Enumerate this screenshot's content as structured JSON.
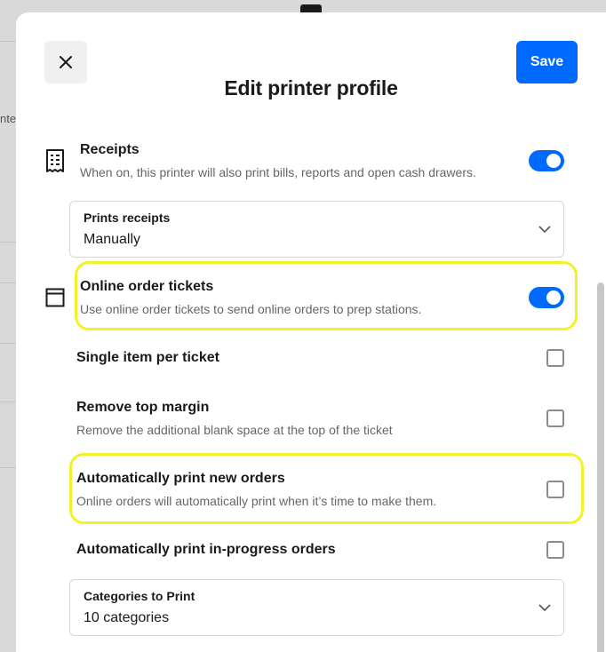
{
  "background": {
    "partial_text": "nte"
  },
  "header": {
    "title": "Edit printer profile",
    "save_label": "Save",
    "close_icon": "close-icon"
  },
  "receipts": {
    "label": "Receipts",
    "description": "When on, this printer will also print bills, reports and open cash drawers.",
    "icon": "receipt-icon",
    "enabled": true
  },
  "prints_receipts": {
    "label": "Prints receipts",
    "value": "Manually"
  },
  "online_order_tickets": {
    "label": "Online order tickets",
    "description": "Use online order tickets to send online orders to prep stations.",
    "icon": "ticket-window-icon",
    "enabled": true
  },
  "options": [
    {
      "label": "Single item per ticket",
      "description": "",
      "checked": false
    },
    {
      "label": "Remove top margin",
      "description": "Remove the additional blank space at the top of the ticket",
      "checked": false
    },
    {
      "label": "Automatically print new orders",
      "description": "Online orders will automatically print when it’s time to make them.",
      "checked": false
    },
    {
      "label": "Automatically print in-progress orders",
      "description": "",
      "checked": false
    }
  ],
  "categories": {
    "label": "Categories to Print",
    "value": "10 categories"
  },
  "colors": {
    "accent": "#006aff",
    "highlight": "#f4f12a"
  }
}
